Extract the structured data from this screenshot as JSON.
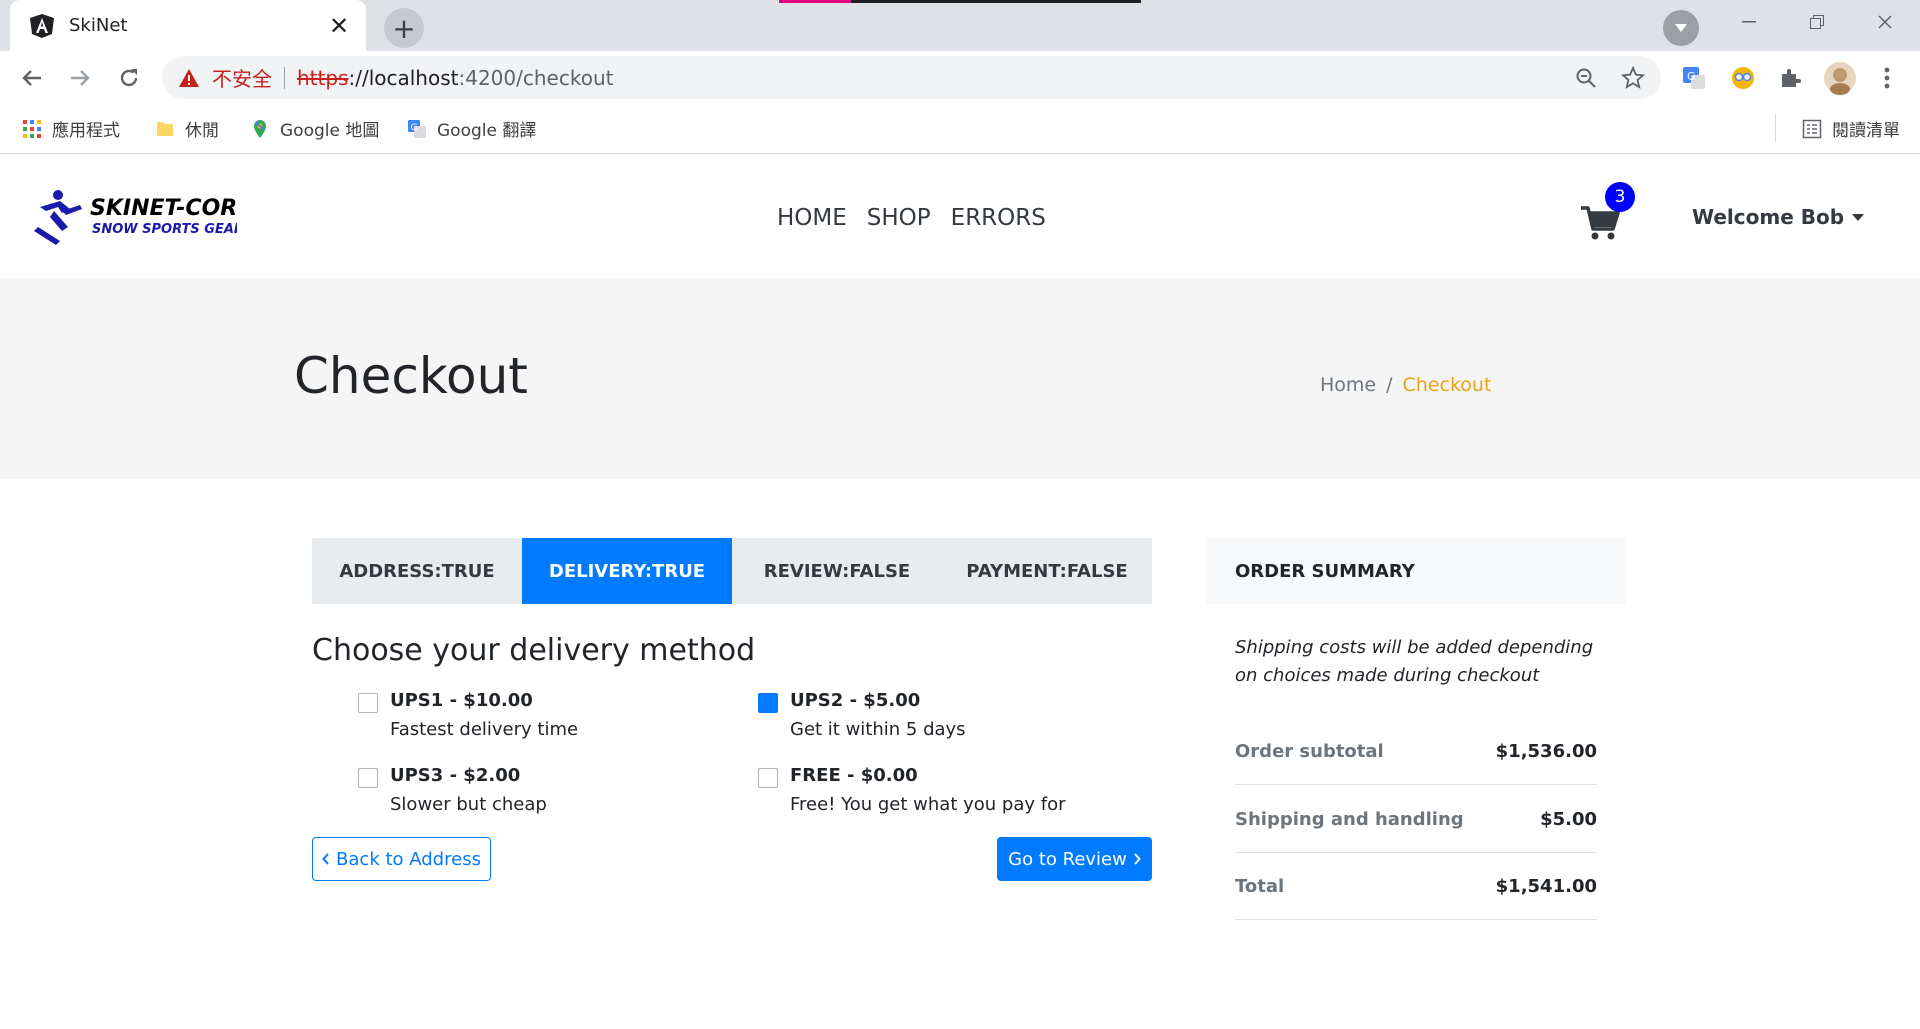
{
  "browser": {
    "tab_title": "SkiNet",
    "new_tab_label": "+",
    "security_label": "不安全",
    "url_scheme": "https",
    "url_host": "://localhost",
    "url_path": ":4200/checkout",
    "bookmarks": [
      {
        "label": "應用程式",
        "icon": "apps-grid-icon"
      },
      {
        "label": "休閒",
        "icon": "folder-icon"
      },
      {
        "label": "Google 地圖",
        "icon": "maps-pin-icon"
      },
      {
        "label": "Google 翻譯",
        "icon": "translate-icon"
      }
    ],
    "reading_list_label": "閱讀清單"
  },
  "navbar": {
    "logo_line1": "SKINET-CORE",
    "logo_line2": "SNOW SPORTS GEAR",
    "links": [
      "HOME",
      "SHOP",
      "ERRORS"
    ],
    "cart_count": "3",
    "user_label": "Welcome Bob"
  },
  "header": {
    "title": "Checkout",
    "breadcrumb": [
      "Home",
      "/",
      "Checkout"
    ]
  },
  "stepper": {
    "steps": [
      {
        "label": "ADDRESS:TRUE",
        "active": false
      },
      {
        "label": "DELIVERY:TRUE",
        "active": true
      },
      {
        "label": "REVIEW:FALSE",
        "active": false
      },
      {
        "label": "PAYMENT:FALSE",
        "active": false
      }
    ]
  },
  "delivery": {
    "title": "Choose your delivery method",
    "options": [
      {
        "name": "UPS1 - $10.00",
        "desc": "Fastest delivery time",
        "selected": false
      },
      {
        "name": "UPS2 - $5.00",
        "desc": "Get it within 5 days",
        "selected": true
      },
      {
        "name": "UPS3 - $2.00",
        "desc": "Slower but cheap",
        "selected": false
      },
      {
        "name": "FREE - $0.00",
        "desc": "Free! You get what you pay for",
        "selected": false
      }
    ],
    "back_label": "Back to Address",
    "next_label": "Go to Review"
  },
  "summary": {
    "title": "ORDER SUMMARY",
    "note": "Shipping costs will be added depending on choices made during checkout",
    "rows": [
      {
        "label": "Order subtotal",
        "value": "$1,536.00"
      },
      {
        "label": "Shipping and handling",
        "value": "$5.00"
      },
      {
        "label": "Total",
        "value": "$1,541.00"
      }
    ]
  },
  "colors": {
    "primary": "#007bff",
    "accent": "#e8a317",
    "badge": "#0000ff"
  }
}
